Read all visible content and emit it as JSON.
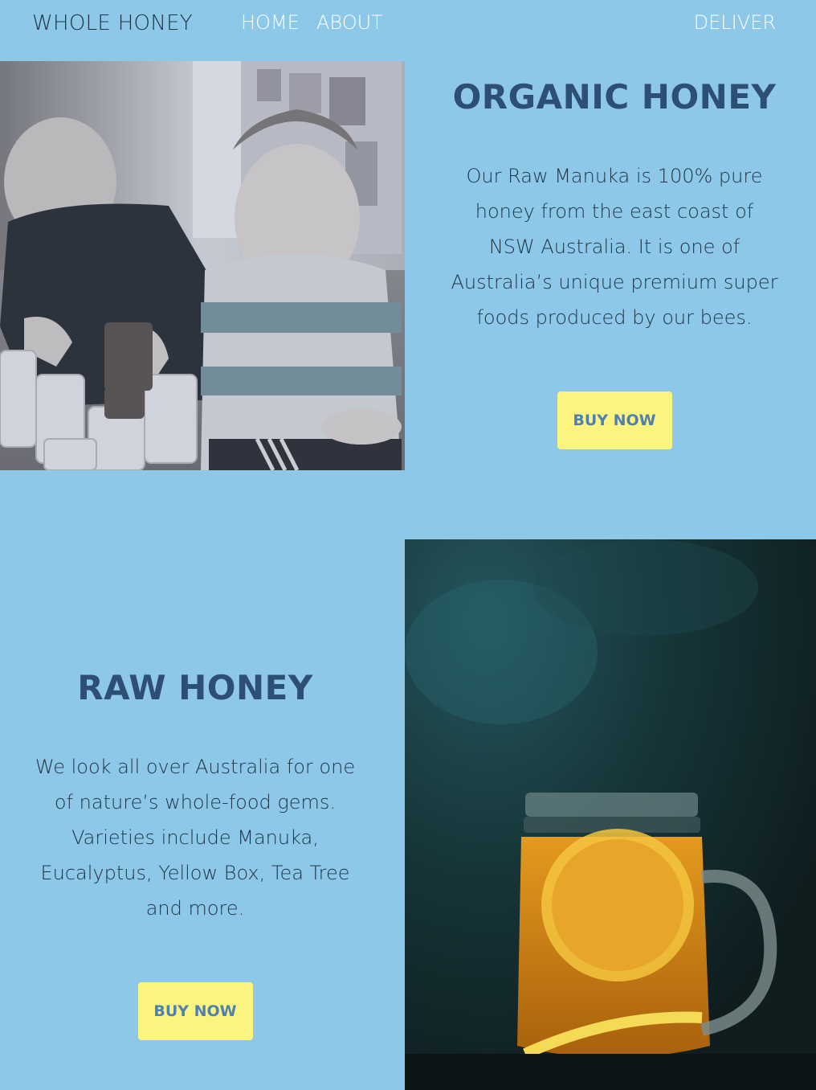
{
  "nav": {
    "brand": "WHOLE HONEY",
    "home": "HOME",
    "about": "ABOUT",
    "deliver": "DELIVER"
  },
  "sections": [
    {
      "title": "ORGANIC HONEY",
      "body": "Our Raw Manuka is 100% pure honey from the east coast of NSW Australia. It is one of Australia’s unique premium super foods produced by our bees.",
      "button": "BUY NOW",
      "image": "kids-with-honey-jars-photo"
    },
    {
      "title": "RAW HONEY",
      "body": "We look all over Australia for one of nature’s whole-food gems. Varieties include Manuka, Eucalyptus, Yellow Box, Tea Tree and more.",
      "button": "BUY NOW",
      "image": "honey-tea-mason-jar-photo"
    }
  ],
  "colors": {
    "background": "#8ec8e8",
    "heading": "#2c4f73",
    "button_bg": "#fbf47e",
    "button_text": "#4f7fb3"
  }
}
